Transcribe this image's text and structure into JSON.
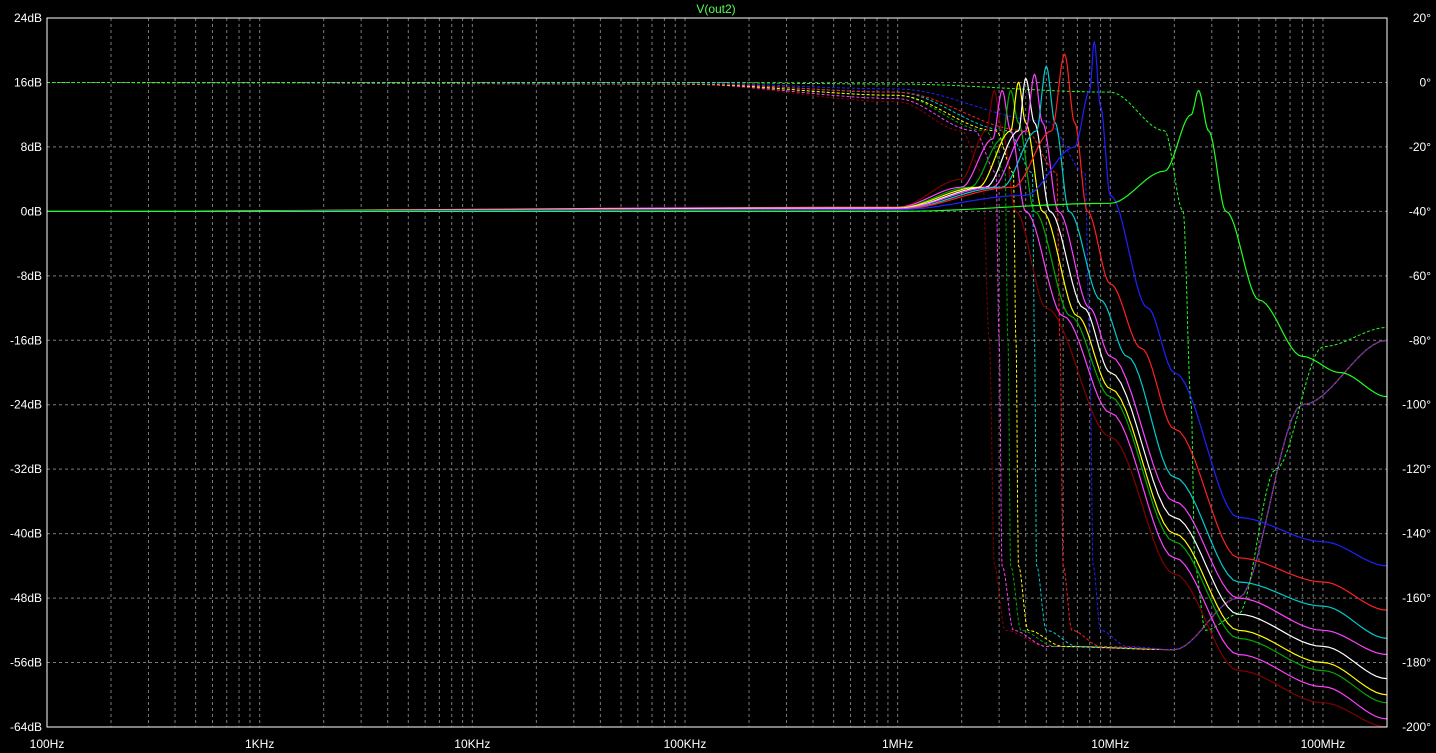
{
  "chart_data": {
    "type": "line",
    "title": "V(out2)",
    "x_scale": "log",
    "x_unit": "Hz",
    "xlim": [
      100,
      200000000
    ],
    "ylim_left_db": [
      -64,
      24
    ],
    "ylim_right_deg": [
      -200,
      20
    ],
    "grid": true,
    "x_ticks": [
      {
        "value": 100,
        "label": "100Hz"
      },
      {
        "value": 1000,
        "label": "1KHz"
      },
      {
        "value": 10000,
        "label": "10KHz"
      },
      {
        "value": 100000,
        "label": "100KHz"
      },
      {
        "value": 1000000,
        "label": "1MHz"
      },
      {
        "value": 10000000,
        "label": "10MHz"
      },
      {
        "value": 100000000,
        "label": "100MHz"
      }
    ],
    "y_left_ticks": [
      {
        "value": 24,
        "label": "24dB"
      },
      {
        "value": 16,
        "label": "16dB"
      },
      {
        "value": 8,
        "label": "8dB"
      },
      {
        "value": 0,
        "label": "0dB"
      },
      {
        "value": -8,
        "label": "-8dB"
      },
      {
        "value": -16,
        "label": "-16dB"
      },
      {
        "value": -24,
        "label": "-24dB"
      },
      {
        "value": -32,
        "label": "-32dB"
      },
      {
        "value": -40,
        "label": "-40dB"
      },
      {
        "value": -48,
        "label": "-48dB"
      },
      {
        "value": -56,
        "label": "-56dB"
      },
      {
        "value": -64,
        "label": "-64dB"
      }
    ],
    "y_right_ticks": [
      {
        "value": 20,
        "label": "20°"
      },
      {
        "value": 0,
        "label": "0°"
      },
      {
        "value": -20,
        "label": "-20°"
      },
      {
        "value": -40,
        "label": "-40°"
      },
      {
        "value": -60,
        "label": "-60°"
      },
      {
        "value": -80,
        "label": "-80°"
      },
      {
        "value": -100,
        "label": "-100°"
      },
      {
        "value": -120,
        "label": "-120°"
      },
      {
        "value": -140,
        "label": "-140°"
      },
      {
        "value": -160,
        "label": "-160°"
      },
      {
        "value": -180,
        "label": "-180°"
      },
      {
        "value": -200,
        "label": "-200°"
      }
    ],
    "series_note_colors": [
      "#ff2020",
      "#2020ff",
      "#20ff20",
      "#00cccc",
      "#ff40ff",
      "#ffffff",
      "#ffff00",
      "#00aa00",
      "#aa0000",
      "#0080ff",
      "#cc00cc",
      "#808080"
    ],
    "magnitude_series": [
      {
        "color": "#800000",
        "points": [
          [
            100,
            0
          ],
          [
            1000000,
            0.5
          ],
          [
            2000000,
            4
          ],
          [
            2600000,
            10
          ],
          [
            2850000,
            15
          ],
          [
            3100000,
            10
          ],
          [
            3600000,
            0
          ],
          [
            5000000,
            -12
          ],
          [
            10000000,
            -28
          ],
          [
            20000000,
            -45
          ],
          [
            40000000,
            -57
          ],
          [
            100000000,
            -61
          ],
          [
            200000000,
            -64
          ]
        ]
      },
      {
        "color": "#ff40ff",
        "points": [
          [
            100,
            0
          ],
          [
            1000000,
            0.5
          ],
          [
            2000000,
            3
          ],
          [
            2800000,
            9
          ],
          [
            3100000,
            15
          ],
          [
            3400000,
            10
          ],
          [
            4000000,
            0
          ],
          [
            6000000,
            -13
          ],
          [
            10000000,
            -25
          ],
          [
            20000000,
            -43
          ],
          [
            40000000,
            -55
          ],
          [
            100000000,
            -59
          ],
          [
            200000000,
            -63
          ]
        ]
      },
      {
        "color": "#00aa00",
        "points": [
          [
            100,
            0
          ],
          [
            1000000,
            0.4
          ],
          [
            2200000,
            3
          ],
          [
            3100000,
            9
          ],
          [
            3400000,
            15
          ],
          [
            3700000,
            11
          ],
          [
            4400000,
            0
          ],
          [
            6500000,
            -13
          ],
          [
            10000000,
            -23
          ],
          [
            20000000,
            -41
          ],
          [
            40000000,
            -53
          ],
          [
            100000000,
            -57
          ],
          [
            200000000,
            -61
          ]
        ]
      },
      {
        "color": "#ffff00",
        "points": [
          [
            100,
            0
          ],
          [
            1000000,
            0.4
          ],
          [
            2400000,
            3
          ],
          [
            3400000,
            10
          ],
          [
            3700000,
            16
          ],
          [
            4000000,
            11
          ],
          [
            4800000,
            0
          ],
          [
            7000000,
            -13
          ],
          [
            10000000,
            -22
          ],
          [
            20000000,
            -40
          ],
          [
            40000000,
            -52
          ],
          [
            100000000,
            -56
          ],
          [
            200000000,
            -60
          ]
        ]
      },
      {
        "color": "#ffffff",
        "points": [
          [
            100,
            0
          ],
          [
            1000000,
            0.3
          ],
          [
            2600000,
            3
          ],
          [
            3700000,
            10
          ],
          [
            4000000,
            16.5
          ],
          [
            4400000,
            11
          ],
          [
            5200000,
            0
          ],
          [
            7500000,
            -12
          ],
          [
            10000000,
            -20
          ],
          [
            20000000,
            -38
          ],
          [
            40000000,
            -50
          ],
          [
            100000000,
            -54
          ],
          [
            200000000,
            -58
          ]
        ]
      },
      {
        "color": "#ff40ff",
        "points": [
          [
            100,
            0
          ],
          [
            1000000,
            0.3
          ],
          [
            2800000,
            3
          ],
          [
            4000000,
            10
          ],
          [
            4400000,
            17
          ],
          [
            4800000,
            11
          ],
          [
            5700000,
            0
          ],
          [
            8000000,
            -12
          ],
          [
            10000000,
            -18
          ],
          [
            20000000,
            -36
          ],
          [
            40000000,
            -48
          ],
          [
            100000000,
            -52
          ],
          [
            200000000,
            -55
          ]
        ]
      },
      {
        "color": "#00cccc",
        "points": [
          [
            100,
            0
          ],
          [
            1000000,
            0.2
          ],
          [
            3100000,
            3
          ],
          [
            4500000,
            10
          ],
          [
            5000000,
            18
          ],
          [
            5500000,
            11
          ],
          [
            6400000,
            0
          ],
          [
            9000000,
            -11
          ],
          [
            12000000,
            -18
          ],
          [
            20000000,
            -33
          ],
          [
            40000000,
            -46
          ],
          [
            100000000,
            -49
          ],
          [
            200000000,
            -53
          ]
        ]
      },
      {
        "color": "#ff2020",
        "points": [
          [
            100,
            0
          ],
          [
            1000000,
            0.2
          ],
          [
            3500000,
            3
          ],
          [
            5300000,
            10
          ],
          [
            6100000,
            19.5
          ],
          [
            6800000,
            11
          ],
          [
            7800000,
            0
          ],
          [
            10000000,
            -9
          ],
          [
            14000000,
            -17
          ],
          [
            20000000,
            -27
          ],
          [
            40000000,
            -43
          ],
          [
            100000000,
            -46
          ],
          [
            200000000,
            -49.5
          ]
        ]
      },
      {
        "color": "#2020ff",
        "points": [
          [
            100,
            0
          ],
          [
            1000000,
            0.2
          ],
          [
            4000000,
            2
          ],
          [
            6800000,
            8
          ],
          [
            8000000,
            15
          ],
          [
            8400000,
            21
          ],
          [
            9000000,
            13
          ],
          [
            10000000,
            2
          ],
          [
            15000000,
            -12
          ],
          [
            20000000,
            -20
          ],
          [
            40000000,
            -38
          ],
          [
            100000000,
            -41
          ],
          [
            200000000,
            -44
          ]
        ]
      },
      {
        "color": "#20ff20",
        "points": [
          [
            100,
            0
          ],
          [
            1000000,
            0
          ],
          [
            10000000,
            1
          ],
          [
            18000000,
            5
          ],
          [
            24000000,
            12
          ],
          [
            26000000,
            15
          ],
          [
            29000000,
            10
          ],
          [
            35000000,
            0
          ],
          [
            50000000,
            -11
          ],
          [
            80000000,
            -18
          ],
          [
            120000000,
            -20
          ],
          [
            200000000,
            -23
          ]
        ]
      }
    ],
    "phase_series": [
      {
        "color": "#800000",
        "points": [
          [
            100,
            0
          ],
          [
            100000,
            -0.5
          ],
          [
            1000000,
            -6
          ],
          [
            2000000,
            -15
          ],
          [
            2500000,
            -28
          ],
          [
            2700000,
            -80
          ],
          [
            2850000,
            -150
          ],
          [
            3200000,
            -170
          ],
          [
            5000000,
            -175
          ],
          [
            20000000,
            -176
          ],
          [
            40000000,
            -160
          ],
          [
            80000000,
            -100
          ],
          [
            200000000,
            -80
          ]
        ]
      },
      {
        "color": "#ff40ff",
        "points": [
          [
            100,
            0
          ],
          [
            100000,
            -0.5
          ],
          [
            1000000,
            -5
          ],
          [
            2300000,
            -15
          ],
          [
            2900000,
            -28
          ],
          [
            3000000,
            -80
          ],
          [
            3100000,
            -150
          ],
          [
            3500000,
            -170
          ],
          [
            5000000,
            -175
          ],
          [
            20000000,
            -176
          ],
          [
            40000000,
            -160
          ],
          [
            80000000,
            -100
          ],
          [
            200000000,
            -80
          ]
        ]
      },
      {
        "color": "#00aa00",
        "points": [
          [
            100,
            0
          ],
          [
            100000,
            -0.4
          ],
          [
            1000000,
            -4
          ],
          [
            2600000,
            -15
          ],
          [
            3200000,
            -28
          ],
          [
            3300000,
            -80
          ],
          [
            3400000,
            -150
          ],
          [
            3800000,
            -170
          ],
          [
            5500000,
            -175
          ],
          [
            20000000,
            -176
          ],
          [
            40000000,
            -160
          ],
          [
            80000000,
            -100
          ],
          [
            200000000,
            -80
          ]
        ]
      },
      {
        "color": "#ffff00",
        "points": [
          [
            100,
            0
          ],
          [
            100000,
            -0.4
          ],
          [
            1000000,
            -4
          ],
          [
            2900000,
            -15
          ],
          [
            3500000,
            -28
          ],
          [
            3600000,
            -80
          ],
          [
            3700000,
            -150
          ],
          [
            4100000,
            -170
          ],
          [
            6000000,
            -175
          ],
          [
            20000000,
            -176
          ],
          [
            40000000,
            -160
          ],
          [
            80000000,
            -100
          ],
          [
            200000000,
            -80
          ]
        ]
      },
      {
        "color": "#00cccc",
        "points": [
          [
            100,
            0
          ],
          [
            100000,
            -0.3
          ],
          [
            1000000,
            -3
          ],
          [
            3300000,
            -15
          ],
          [
            4300000,
            -28
          ],
          [
            4400000,
            -80
          ],
          [
            4500000,
            -150
          ],
          [
            5000000,
            -170
          ],
          [
            7000000,
            -175
          ],
          [
            20000000,
            -176
          ],
          [
            40000000,
            -160
          ],
          [
            80000000,
            -100
          ],
          [
            200000000,
            -80
          ]
        ]
      },
      {
        "color": "#ff2020",
        "points": [
          [
            100,
            0
          ],
          [
            100000,
            -0.3
          ],
          [
            1000000,
            -3
          ],
          [
            4000000,
            -15
          ],
          [
            5600000,
            -28
          ],
          [
            5800000,
            -80
          ],
          [
            6000000,
            -150
          ],
          [
            6600000,
            -170
          ],
          [
            9000000,
            -175
          ],
          [
            20000000,
            -176
          ],
          [
            40000000,
            -160
          ],
          [
            80000000,
            -100
          ],
          [
            200000000,
            -80
          ]
        ]
      },
      {
        "color": "#2020ff",
        "points": [
          [
            100,
            0
          ],
          [
            100000,
            -0.2
          ],
          [
            1000000,
            -2
          ],
          [
            5000000,
            -12
          ],
          [
            7600000,
            -28
          ],
          [
            8000000,
            -80
          ],
          [
            8300000,
            -150
          ],
          [
            9000000,
            -170
          ],
          [
            12000000,
            -175
          ],
          [
            20000000,
            -176
          ],
          [
            40000000,
            -160
          ],
          [
            80000000,
            -100
          ],
          [
            200000000,
            -80
          ]
        ]
      },
      {
        "color": "#20ff20",
        "points": [
          [
            100,
            0
          ],
          [
            100000,
            0
          ],
          [
            1000000,
            -0.5
          ],
          [
            10000000,
            -3
          ],
          [
            18000000,
            -15
          ],
          [
            22000000,
            -40
          ],
          [
            24000000,
            -100
          ],
          [
            25000000,
            -150
          ],
          [
            28000000,
            -170
          ],
          [
            40000000,
            -165
          ],
          [
            60000000,
            -120
          ],
          [
            100000000,
            -82
          ],
          [
            200000000,
            -76
          ]
        ]
      }
    ]
  }
}
